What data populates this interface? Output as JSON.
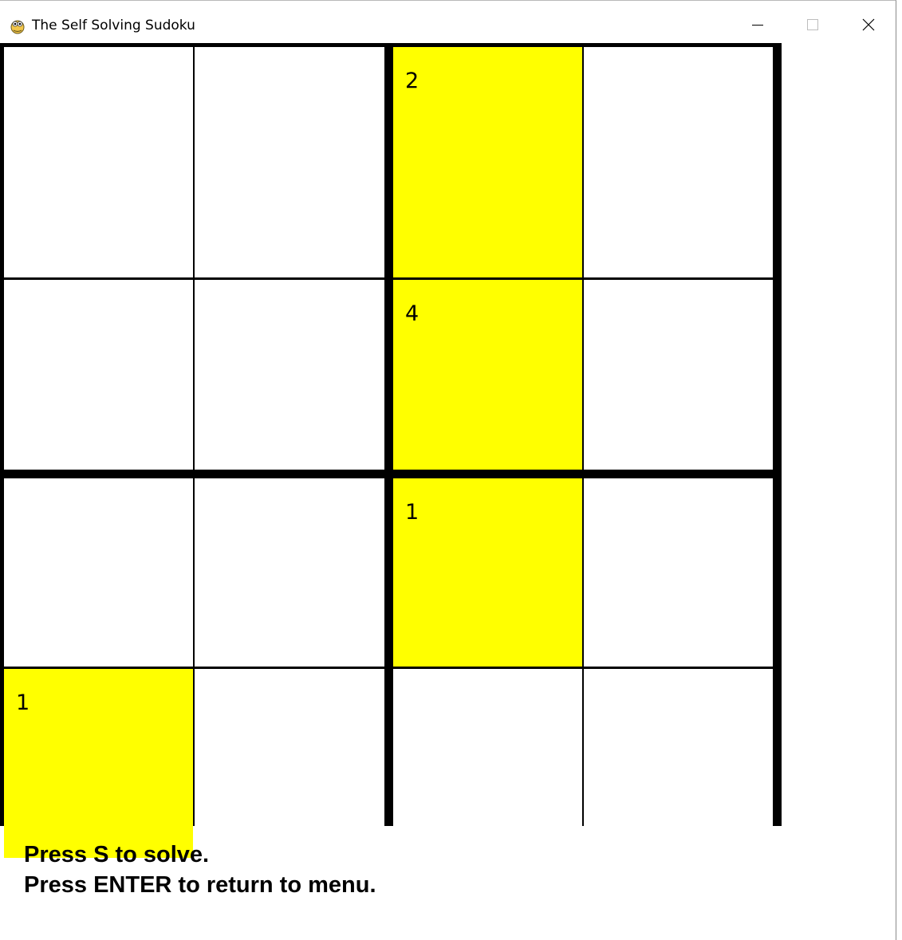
{
  "window": {
    "title": "The Self Solving Sudoku",
    "icon": "pygame-snake-icon",
    "controls": {
      "minimize_icon": "minimize-icon",
      "maximize_icon": "maximize-icon",
      "close_icon": "close-icon"
    }
  },
  "board": {
    "size": 4,
    "box_size": 2,
    "given_color": "#ffff00",
    "empty_color": "#ffffff",
    "grid_color": "#000000",
    "cells": [
      [
        "",
        "",
        "2",
        ""
      ],
      [
        "",
        "",
        "4",
        ""
      ],
      [
        "",
        "",
        "1",
        ""
      ],
      [
        "1",
        "",
        "",
        ""
      ]
    ]
  },
  "instructions": {
    "line1": "Press S to solve.",
    "line2": "Press ENTER to return to menu."
  }
}
